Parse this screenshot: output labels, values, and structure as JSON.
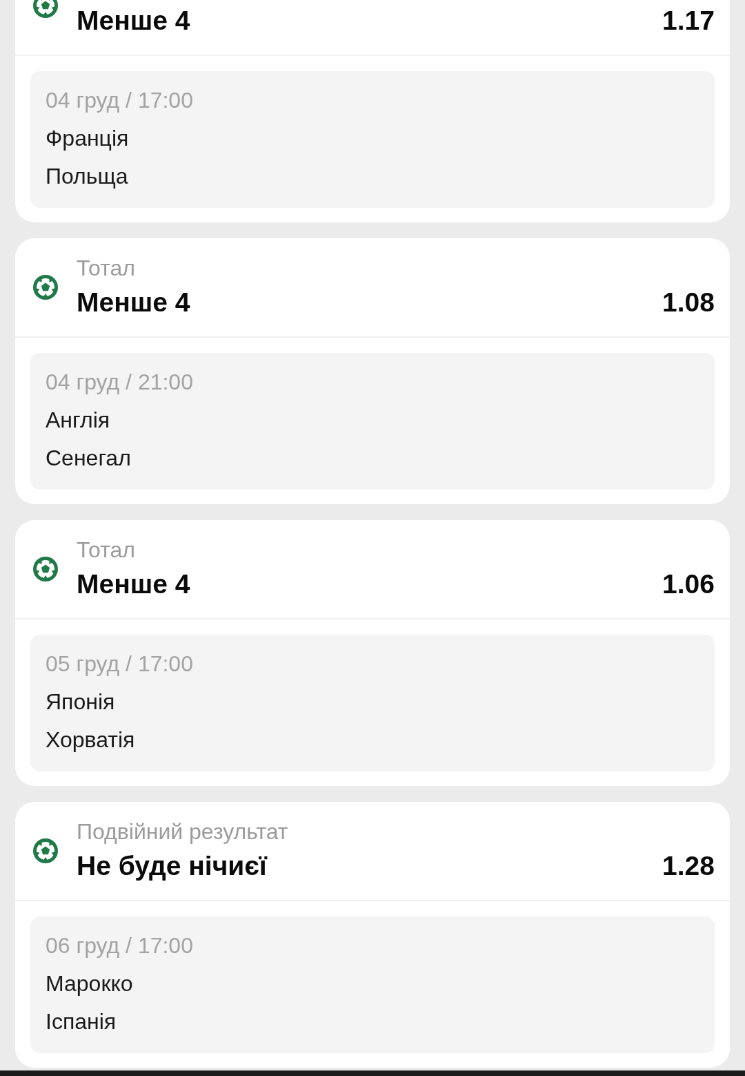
{
  "bets": [
    {
      "selection": "Менше 4",
      "odds": "1.17",
      "date": "04 груд / 17:00",
      "teams": [
        "Франція",
        "Польща"
      ]
    },
    {
      "market": "Тотал",
      "selection": "Менше 4",
      "odds": "1.08",
      "date": "04 груд / 21:00",
      "teams": [
        "Англія",
        "Сенегал"
      ]
    },
    {
      "market": "Тотал",
      "selection": "Менше 4",
      "odds": "1.06",
      "date": "05 груд / 17:00",
      "teams": [
        "Японія",
        "Хорватія"
      ]
    },
    {
      "market": "Подвійний результат",
      "selection": "Не буде нічиєї",
      "odds": "1.28",
      "date": "06 груд / 17:00",
      "teams": [
        "Марокко",
        "Іспанія"
      ]
    }
  ]
}
